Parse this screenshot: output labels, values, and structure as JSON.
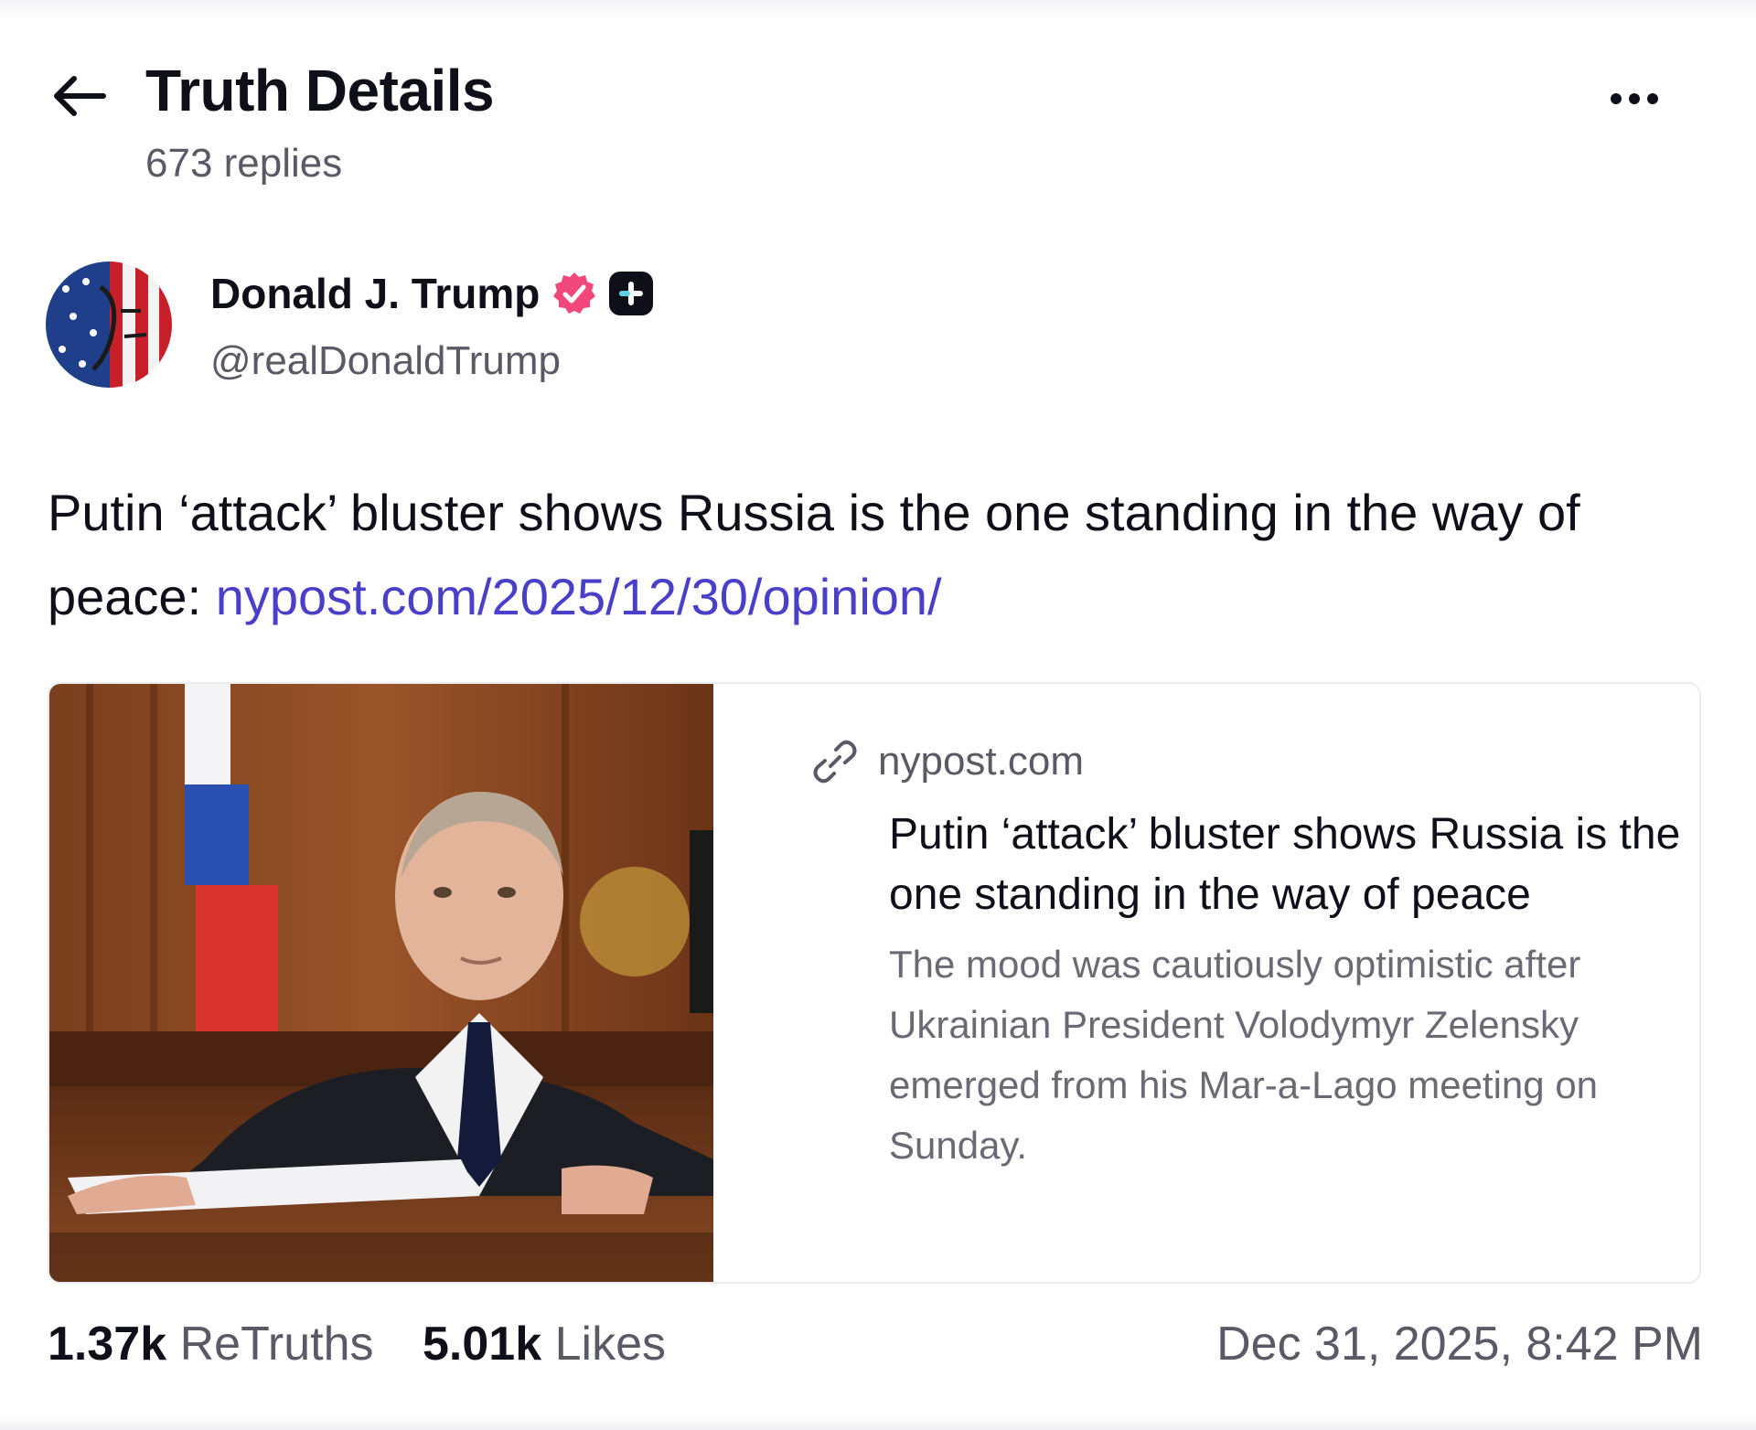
{
  "header": {
    "title": "Truth Details",
    "reply_count": "673 replies",
    "back_icon": "arrow-left-icon",
    "more_icon": "more-horizontal-icon"
  },
  "author": {
    "display_name": "Donald J. Trump",
    "handle": "@realDonaldTrump",
    "verified_icon": "verified-badge-icon",
    "plus_icon": "truth-plus-icon",
    "verified_color": "#f2477a"
  },
  "post": {
    "text": "Putin ‘attack’ bluster shows Russia is the one standing in the way of peace: ",
    "link": "nypost.com/2025/12/30/opinion/",
    "link_color": "#4a3fc8"
  },
  "link_card": {
    "domain": "nypost.com",
    "link_icon": "link-icon",
    "title": "Putin ‘attack’ bluster shows Russia is the one standing in the way of peace",
    "description": "The mood was cautiously optimistic after Ukrainian President Volodymyr Zelensky emerged from his Mar-a-Lago meeting on Sunday."
  },
  "stats": {
    "retruths_count": "1.37k",
    "retruths_label": "ReTruths",
    "likes_count": "5.01k",
    "likes_label": "Likes",
    "timestamp": "Dec 31, 2025, 8:42 PM"
  }
}
